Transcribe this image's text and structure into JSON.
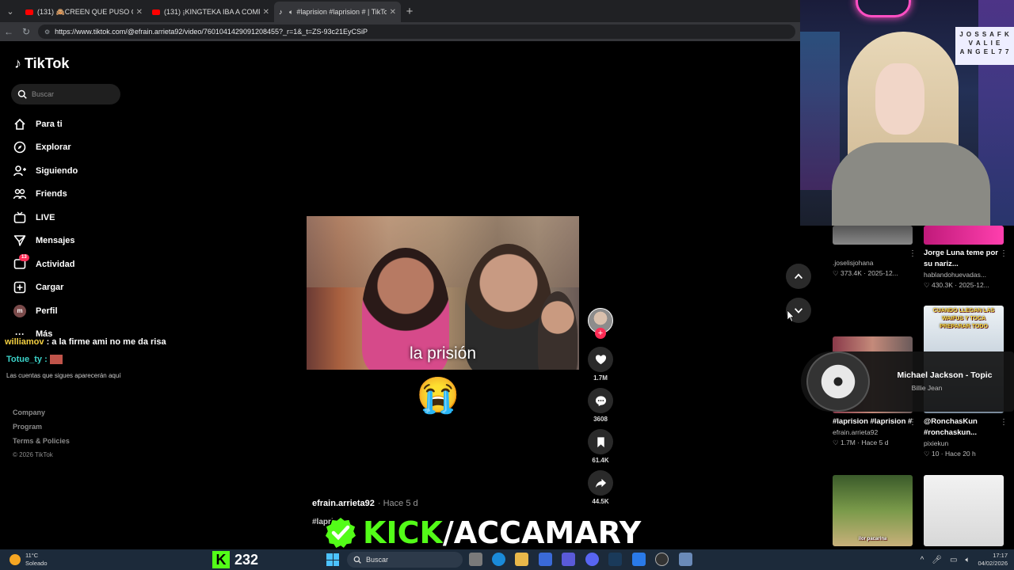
{
  "browser": {
    "tabs": [
      {
        "title": "(131) 🙈CREEN QUE PUSO CÁMA",
        "favicon": "youtube-icon",
        "active": false
      },
      {
        "title": "(131) ¡KINGTEKA IBA A COMPRAR",
        "favicon": "youtube-icon",
        "active": false
      },
      {
        "title": "#laprision #laprision # | TikTok",
        "favicon": "tiktok-icon",
        "active": true
      }
    ],
    "url": "https://www.tiktok.com/@efrain.arrieta92/video/7601041429091208455?_r=1&_t=ZS-93c21EyCSiP"
  },
  "tiktok": {
    "logo": "TikTok",
    "search_placeholder": "Buscar",
    "nav": [
      {
        "label": "Para ti",
        "icon": "home-icon"
      },
      {
        "label": "Explorar",
        "icon": "compass-icon"
      },
      {
        "label": "Siguiendo",
        "icon": "following-icon"
      },
      {
        "label": "Friends",
        "icon": "friends-icon"
      },
      {
        "label": "LIVE",
        "icon": "live-icon"
      },
      {
        "label": "Mensajes",
        "icon": "messages-icon"
      },
      {
        "label": "Actividad",
        "icon": "activity-icon",
        "badge": "13"
      },
      {
        "label": "Cargar",
        "icon": "upload-icon"
      },
      {
        "label": "Perfil",
        "icon": "profile-avatar",
        "avatar_letter": "m"
      },
      {
        "label": "Más",
        "icon": "more-icon"
      }
    ],
    "following_hint": "Las cuentas que sigues aparecerán aquí",
    "footer": [
      "Company",
      "Program",
      "Terms & Policies"
    ],
    "copyright": "© 2026 TikTok",
    "video": {
      "caption": "la prisión",
      "emoji": "😭",
      "author": "efrain.arrieta92",
      "ago": "· Hace 5 d",
      "hashtag": "#laprision"
    },
    "actions": {
      "likes": "1.7M",
      "comments": "3608",
      "saves": "61.4K",
      "shares": "44.5K"
    }
  },
  "chat": [
    {
      "user": "williamov",
      "message": " : a la firme ami no me da risa"
    },
    {
      "user": "Totue_ty",
      "message": " :"
    }
  ],
  "webcam": {
    "sign": [
      "J O S S A F K",
      "V A L I E",
      "A N G E L 7 7"
    ]
  },
  "recommendations": [
    {
      "author": ".joselisjohana",
      "meta": "♡ 373.4K · 2025-12..."
    },
    {
      "caption": "Jorge Luna teme por su nariz...",
      "author": "hablandohuevadas...",
      "meta": "♡ 430.3K · 2025-12..."
    },
    {
      "caption": "#laprision #laprision #",
      "author": "efrain.arrieta92",
      "meta": "♡ 1.7M · Hace 5 d"
    },
    {
      "thumb_text": "CUANDO LLEGAN LAS WAIFUS Y TOCA PREPARAR TODO",
      "caption": "@RonchasKun #ronchaskun...",
      "author": "pixiekun",
      "meta": "♡ 10 · Hace 20 h"
    },
    {
      "thumb_text": "ilor pacarina"
    },
    {
      "thumb_text": ""
    }
  ],
  "music_card": {
    "title": "Michael Jackson - Topic",
    "subtitle": "Billie Jean"
  },
  "kick": {
    "brand": "KICK",
    "channel": "/ACCAMARY",
    "viewers": "232"
  },
  "taskbar": {
    "temp": "11°C",
    "weather": "Soleado",
    "search": "Buscar",
    "time": "17:17",
    "date": "04/02/2026"
  }
}
